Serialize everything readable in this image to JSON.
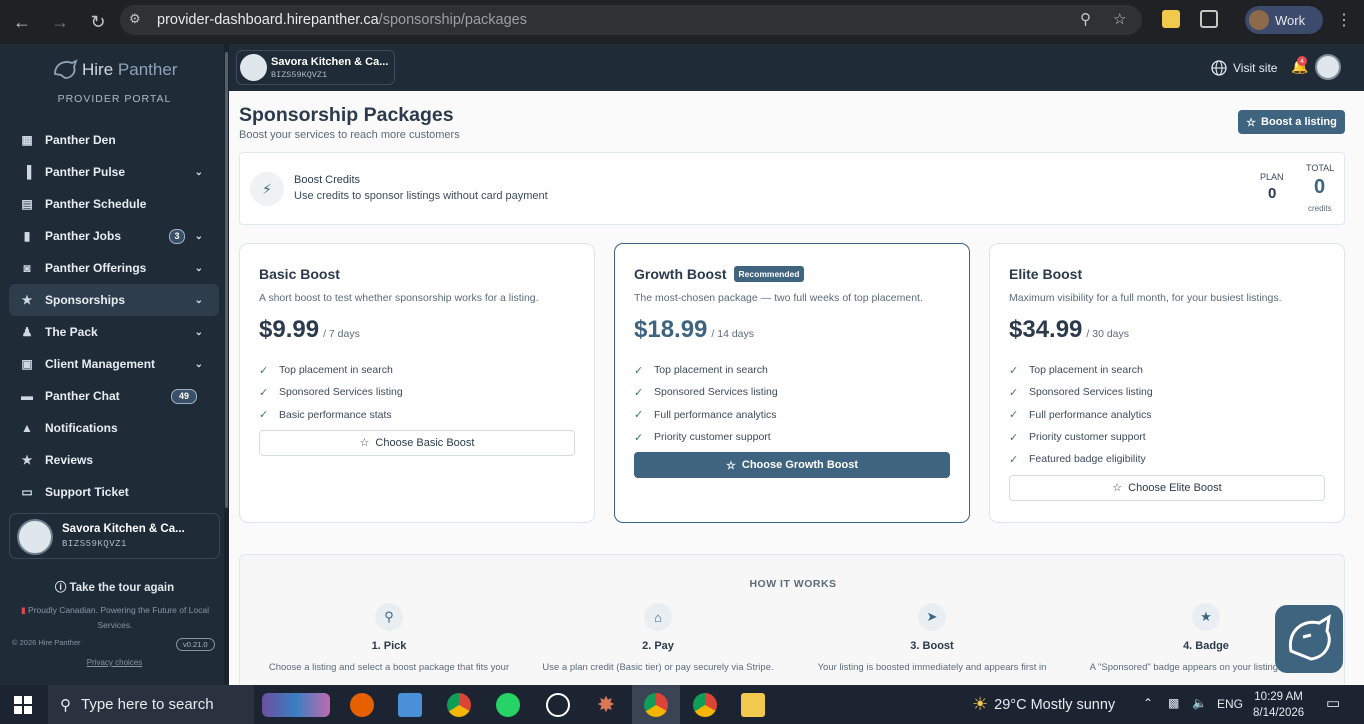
{
  "browser": {
    "url_host": "provider-dashboard.hirepanther.ca",
    "url_path": "/sponsorship/packages",
    "profile_label": "Work"
  },
  "sidebar": {
    "logo_hire": "Hire",
    "logo_panther": "Panther",
    "portal_label": "PROVIDER PORTAL",
    "items": [
      {
        "label": "Panther Den",
        "icon": "grid-icon"
      },
      {
        "label": "Panther Pulse",
        "icon": "bar-chart-icon",
        "chevron": true
      },
      {
        "label": "Panther Schedule",
        "icon": "calendar-icon"
      },
      {
        "label": "Panther Jobs",
        "icon": "bookmark-icon",
        "badge": "3",
        "chevron": true
      },
      {
        "label": "Panther Offerings",
        "icon": "bag-icon",
        "chevron": true
      },
      {
        "label": "Sponsorships",
        "icon": "star-icon",
        "chevron": true,
        "active": true
      },
      {
        "label": "The Pack",
        "icon": "users-icon",
        "chevron": true
      },
      {
        "label": "Client Management",
        "icon": "id-card-icon",
        "chevron": true
      },
      {
        "label": "Panther Chat",
        "icon": "chat-icon",
        "badge": "49"
      },
      {
        "label": "Notifications",
        "icon": "bell-icon"
      },
      {
        "label": "Reviews",
        "icon": "star-icon"
      },
      {
        "label": "Support Ticket",
        "icon": "ticket-icon"
      }
    ],
    "business_name": "Savora Kitchen & Ca...",
    "business_id": "BIZS59KQVZ1",
    "tour_label": "Take the tour again",
    "canada_text": "Proudly Canadian. Powering the Future of Local Services.",
    "copyright": "© 2026 Hire Panther",
    "version": "v0.21.0",
    "privacy": "Privacy choices"
  },
  "topbar": {
    "business_name": "Savora Kitchen & Ca...",
    "business_id": "BIZS59KQVZ1",
    "visit_site": "Visit site",
    "notification_count": "4"
  },
  "page": {
    "title": "Sponsorship Packages",
    "subtitle": "Boost your services to reach more customers",
    "boost_button": "Boost a listing"
  },
  "credits": {
    "title": "Boost Credits",
    "subtitle": "Use credits to sponsor listings without card payment",
    "plan_label": "PLAN",
    "plan_value": "0",
    "total_label": "TOTAL",
    "total_value": "0",
    "total_unit": "credits"
  },
  "packages": [
    {
      "name": "Basic Boost",
      "description": "A short boost to test whether sponsorship works for a listing.",
      "price": "$9.99",
      "period": "/ 7 days",
      "features": [
        "Top placement in search",
        "Sponsored Services listing",
        "Basic performance stats"
      ],
      "button": "Choose Basic Boost"
    },
    {
      "name": "Growth Boost",
      "tag": "Recommended",
      "description": "The most-chosen package — two full weeks of top placement.",
      "price": "$18.99",
      "period": "/ 14 days",
      "features": [
        "Top placement in search",
        "Sponsored Services listing",
        "Full performance analytics",
        "Priority customer support"
      ],
      "button": "Choose Growth Boost"
    },
    {
      "name": "Elite Boost",
      "description": "Maximum visibility for a full month, for your busiest listings.",
      "price": "$34.99",
      "period": "/ 30 days",
      "features": [
        "Top placement in search",
        "Sponsored Services listing",
        "Full performance analytics",
        "Priority customer support",
        "Featured badge eligibility"
      ],
      "button": "Choose Elite Boost"
    }
  ],
  "how_it_works": {
    "title": "HOW IT WORKS",
    "steps": [
      {
        "name": "1. Pick",
        "icon": "search-icon",
        "text": "Choose a listing and select a boost package that fits your"
      },
      {
        "name": "2. Pay",
        "icon": "cart-icon",
        "text": "Use a plan credit (Basic tier) or pay securely via Stripe."
      },
      {
        "name": "3. Boost",
        "icon": "rocket-icon",
        "text": "Your listing is boosted immediately and appears first in"
      },
      {
        "name": "4. Badge",
        "icon": "star-icon",
        "text": "A \"Sponsored\" badge appears on your listing for the full"
      }
    ]
  },
  "taskbar": {
    "search_placeholder": "Type here to search",
    "weather": "29°C  Mostly sunny",
    "lang": "ENG",
    "time": "10:29 AM",
    "date": "8/14/2026"
  }
}
